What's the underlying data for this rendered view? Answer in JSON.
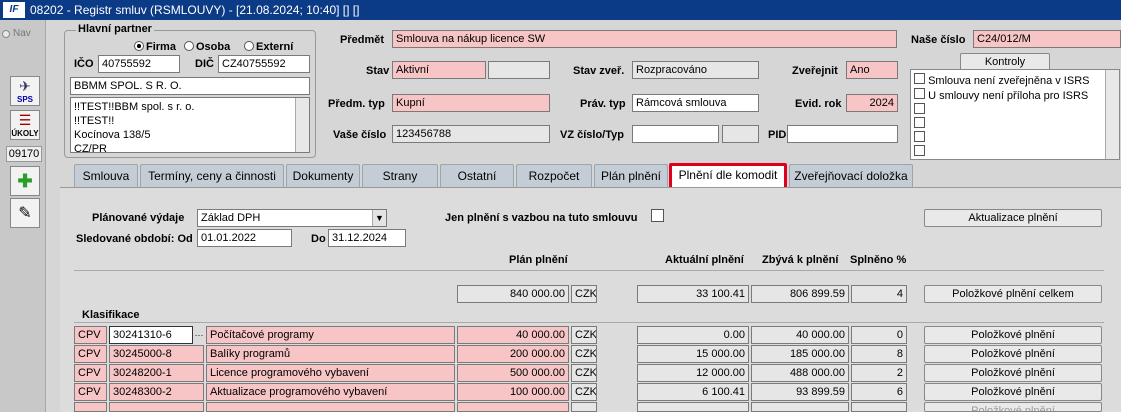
{
  "window": {
    "title": "08202 - Registr smluv (RSMLOUVY) - [21.08.2024; 10:40] [] []",
    "logo": "IF"
  },
  "leftbar": {
    "nav_label": "Nav",
    "sps_label": "SPS",
    "ukoly_label": "ÚKOLY",
    "counter": "09170"
  },
  "partner": {
    "legend": "Hlavní partner",
    "radio_firma": "Firma",
    "radio_osoba": "Osoba",
    "radio_externi": "Externí",
    "ico_label": "IČO",
    "ico_value": "40755592",
    "dic_label": "DIČ",
    "dic_value": "CZ40755592",
    "name": "BBMM SPOL. S R. O.",
    "address_lines": [
      "!!TEST!!BBM spol. s r. o.",
      "!!TEST!!",
      "Kocínova 138/5",
      "CZ/PR"
    ]
  },
  "form": {
    "predmet_label": "Předmět",
    "predmet_value": "Smlouva na nákup licence SW",
    "nase_cislo_label": "Naše číslo",
    "nase_cislo_value": "C24/012/M",
    "kontroly_button": "Kontroly",
    "stav_label": "Stav",
    "stav_value": "Aktivní",
    "stav_zver_label": "Stav zveř.",
    "stav_zver_value": "Rozpracováno",
    "zverejnit_label": "Zveřejnit",
    "zverejnit_value": "Ano",
    "predm_typ_label": "Předm. typ",
    "predm_typ_value": "Kupní",
    "prav_typ_label": "Práv. typ",
    "prav_typ_value": "Rámcová smlouva",
    "evid_rok_label": "Evid. rok",
    "evid_rok_value": "2024",
    "vase_cislo_label": "Vaše číslo",
    "vase_cislo_value": "123456788",
    "vz_label": "VZ číslo/Typ",
    "pid_label": "PID"
  },
  "kontroly": [
    "Smlouva není zveřejněna v ISRS",
    "U smlouvy není příloha pro ISRS"
  ],
  "tabs": [
    "Smlouva",
    "Termíny, ceny a činnosti",
    "Dokumenty",
    "Strany",
    "Ostatní",
    "Rozpočet",
    "Plán plnění",
    "Plnění dle komodit",
    "Zveřejňovací doložka"
  ],
  "panel": {
    "planovane_label": "Plánované výdaje",
    "planovane_value": "Základ DPH",
    "jen_plneni_label": "Jen plnění s vazbou na tuto smlouvu",
    "aktualizace_button": "Aktualizace plnění",
    "sledovane_label": "Sledované období: Od",
    "od_value": "01.01.2022",
    "do_label": "Do",
    "do_value": "31.12.2024",
    "col_plan": "Plán plnění",
    "col_aktualni": "Aktuální plnění",
    "col_zbyva": "Zbývá k plnění",
    "col_splneno": "Splněno %",
    "total_plan": "840 000.00",
    "total_currency": "CZK",
    "total_aktualni": "33 100.41",
    "total_zbyva": "806 899.59",
    "total_splneno": "4",
    "celkem_button": "Položkové plnění celkem",
    "klasifikace_label": "Klasifikace",
    "row_button": "Položkové plnění",
    "ellipsis": "···",
    "rows": [
      {
        "type": "CPV",
        "code": "30241310-6",
        "name": "Počítačové programy",
        "plan": "40 000.00",
        "cur": "CZK",
        "akt": "0.00",
        "zbyva": "40 000.00",
        "spl": "0"
      },
      {
        "type": "CPV",
        "code": "30245000-8",
        "name": "Balíky programů",
        "plan": "200 000.00",
        "cur": "CZK",
        "akt": "15 000.00",
        "zbyva": "185 000.00",
        "spl": "8"
      },
      {
        "type": "CPV",
        "code": "30248200-1",
        "name": "Licence programového vybavení",
        "plan": "500 000.00",
        "cur": "CZK",
        "akt": "12 000.00",
        "zbyva": "488 000.00",
        "spl": "2"
      },
      {
        "type": "CPV",
        "code": "30248300-2",
        "name": "Aktualizace programového vybavení",
        "plan": "100 000.00",
        "cur": "CZK",
        "akt": "6 100.41",
        "zbyva": "93 899.59",
        "spl": "6"
      }
    ]
  }
}
